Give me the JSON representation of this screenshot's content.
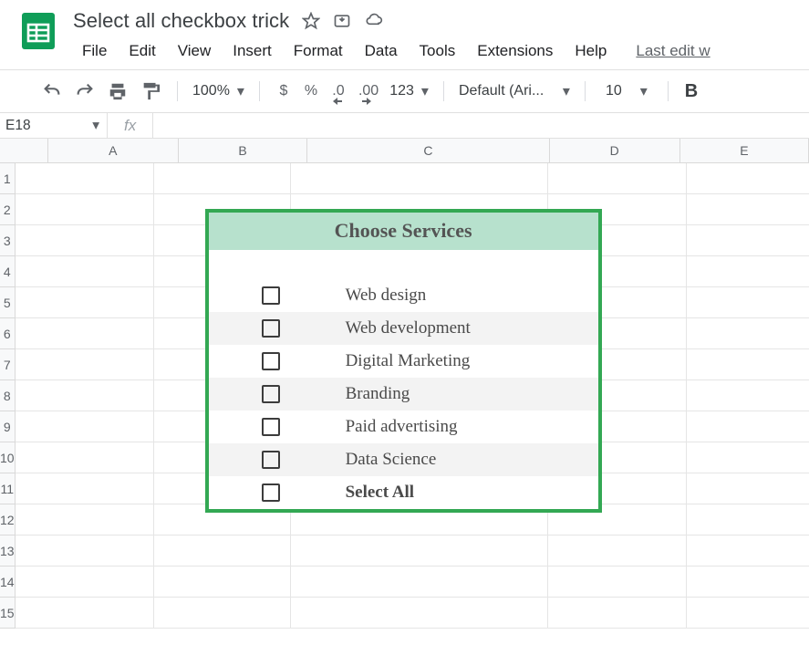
{
  "header": {
    "doc_title": "Select all checkbox trick",
    "menus": [
      "File",
      "Edit",
      "View",
      "Insert",
      "Format",
      "Data",
      "Tools",
      "Extensions",
      "Help"
    ],
    "last_edit": "Last edit w"
  },
  "toolbar": {
    "zoom": "100%",
    "currency": "$",
    "percent": "%",
    "dec_decrease": ".0",
    "dec_increase": ".00",
    "more_formats": "123",
    "font": "Default (Ari...",
    "font_size": "10",
    "bold": "B"
  },
  "formula": {
    "name_box": "E18",
    "fx": "fx"
  },
  "columns": [
    "A",
    "B",
    "C",
    "D",
    "E"
  ],
  "rows": [
    "1",
    "2",
    "3",
    "4",
    "5",
    "6",
    "7",
    "8",
    "9",
    "10",
    "11",
    "12",
    "13",
    "14",
    "15"
  ],
  "panel": {
    "title": "Choose Services",
    "items": [
      {
        "label": "Web design",
        "bold": false,
        "alt": false
      },
      {
        "label": "Web development",
        "bold": false,
        "alt": true
      },
      {
        "label": "Digital Marketing",
        "bold": false,
        "alt": false
      },
      {
        "label": "Branding",
        "bold": false,
        "alt": true
      },
      {
        "label": "Paid advertising",
        "bold": false,
        "alt": false
      },
      {
        "label": "Data Science",
        "bold": false,
        "alt": true
      },
      {
        "label": "Select All",
        "bold": true,
        "alt": false
      }
    ]
  }
}
